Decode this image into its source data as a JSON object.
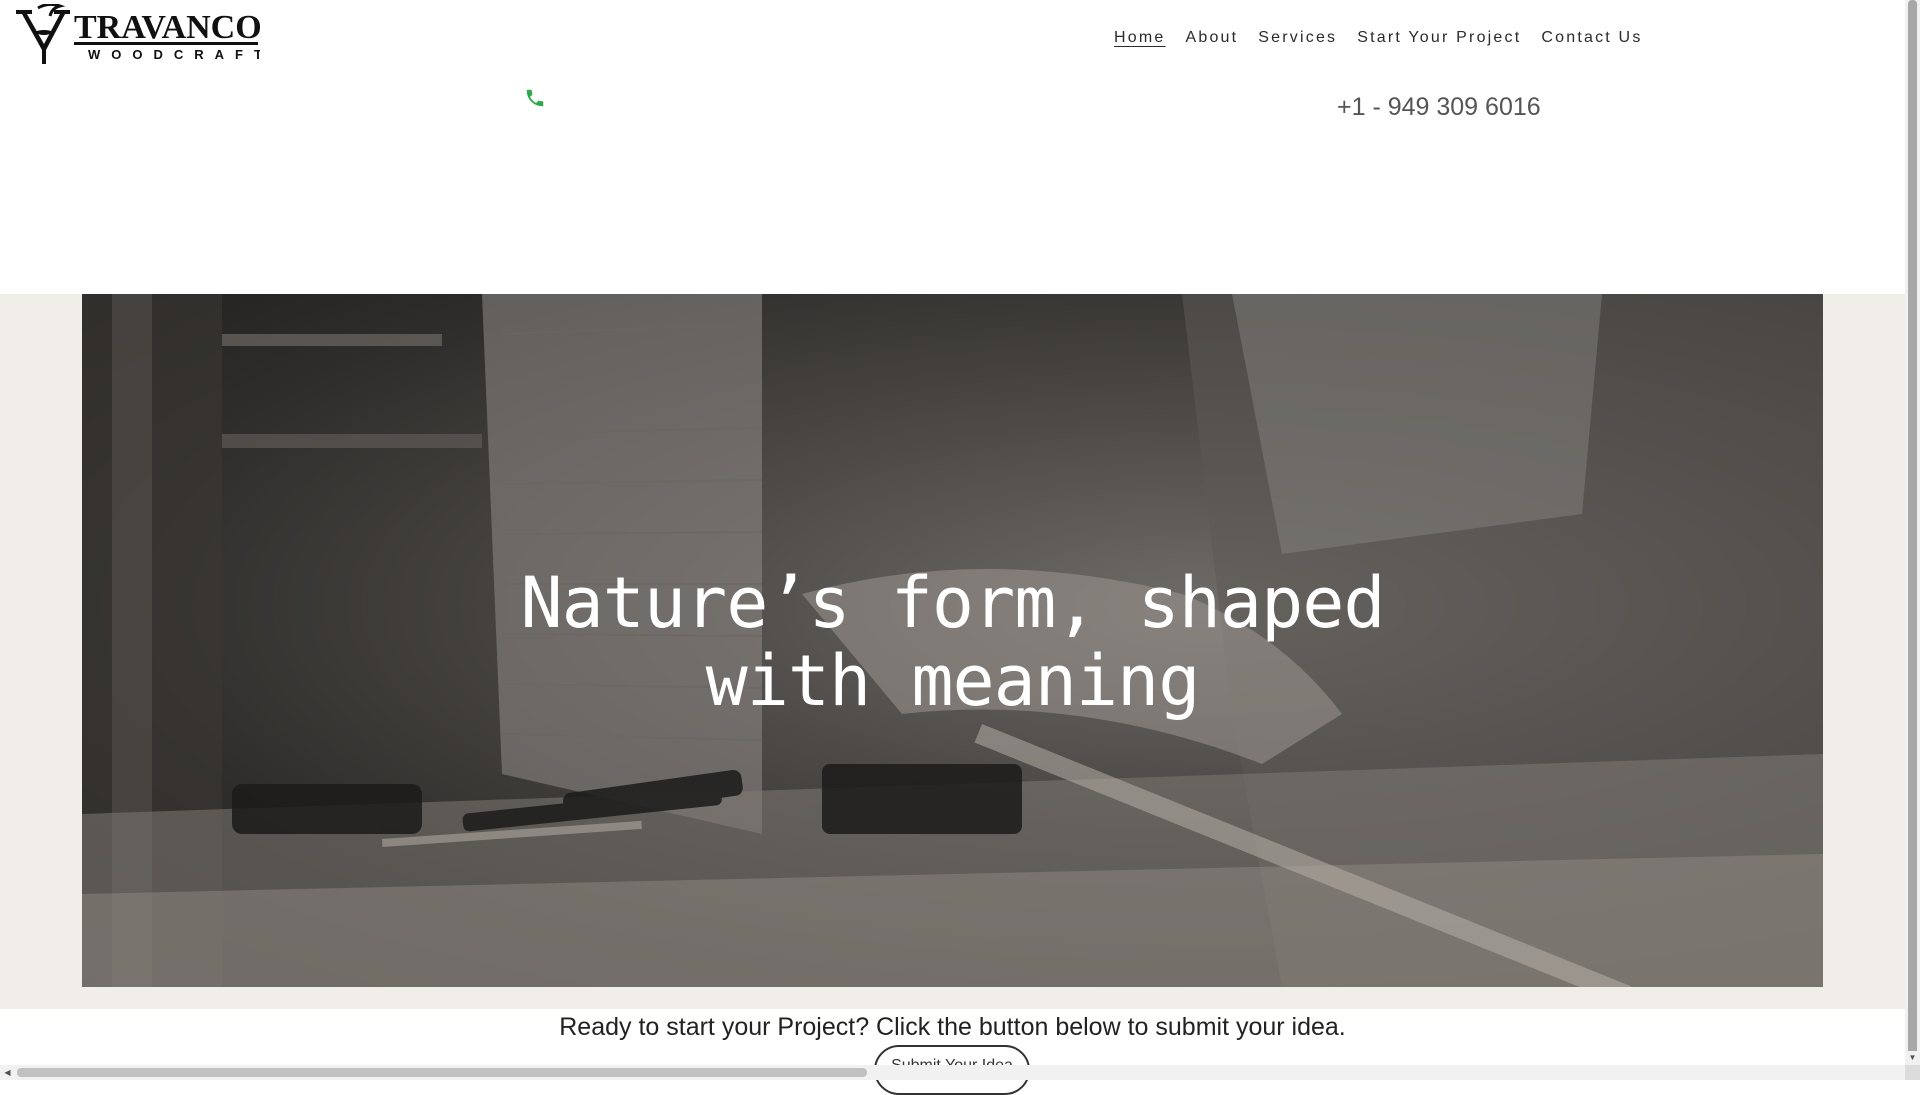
{
  "brand": {
    "name": "TRAVANCORE",
    "tagline": "WOODCRAFT"
  },
  "nav": {
    "items": [
      {
        "label": "Home",
        "active": true
      },
      {
        "label": "About"
      },
      {
        "label": "Services"
      },
      {
        "label": "Start Your Project"
      },
      {
        "label": "Contact Us"
      }
    ]
  },
  "contact": {
    "phone": "+1 - 949 309 6016",
    "phone_icon": "phone-icon",
    "phone_icon_color": "#2ea84a"
  },
  "hero": {
    "title": "Nature’s form, shaped with meaning"
  },
  "cta": {
    "text": "Ready to start your Project? Click the button below to submit your idea.",
    "button_label": "Submit Your Idea"
  },
  "colors": {
    "hero_band": "#f1ede8",
    "text": "#222222"
  }
}
